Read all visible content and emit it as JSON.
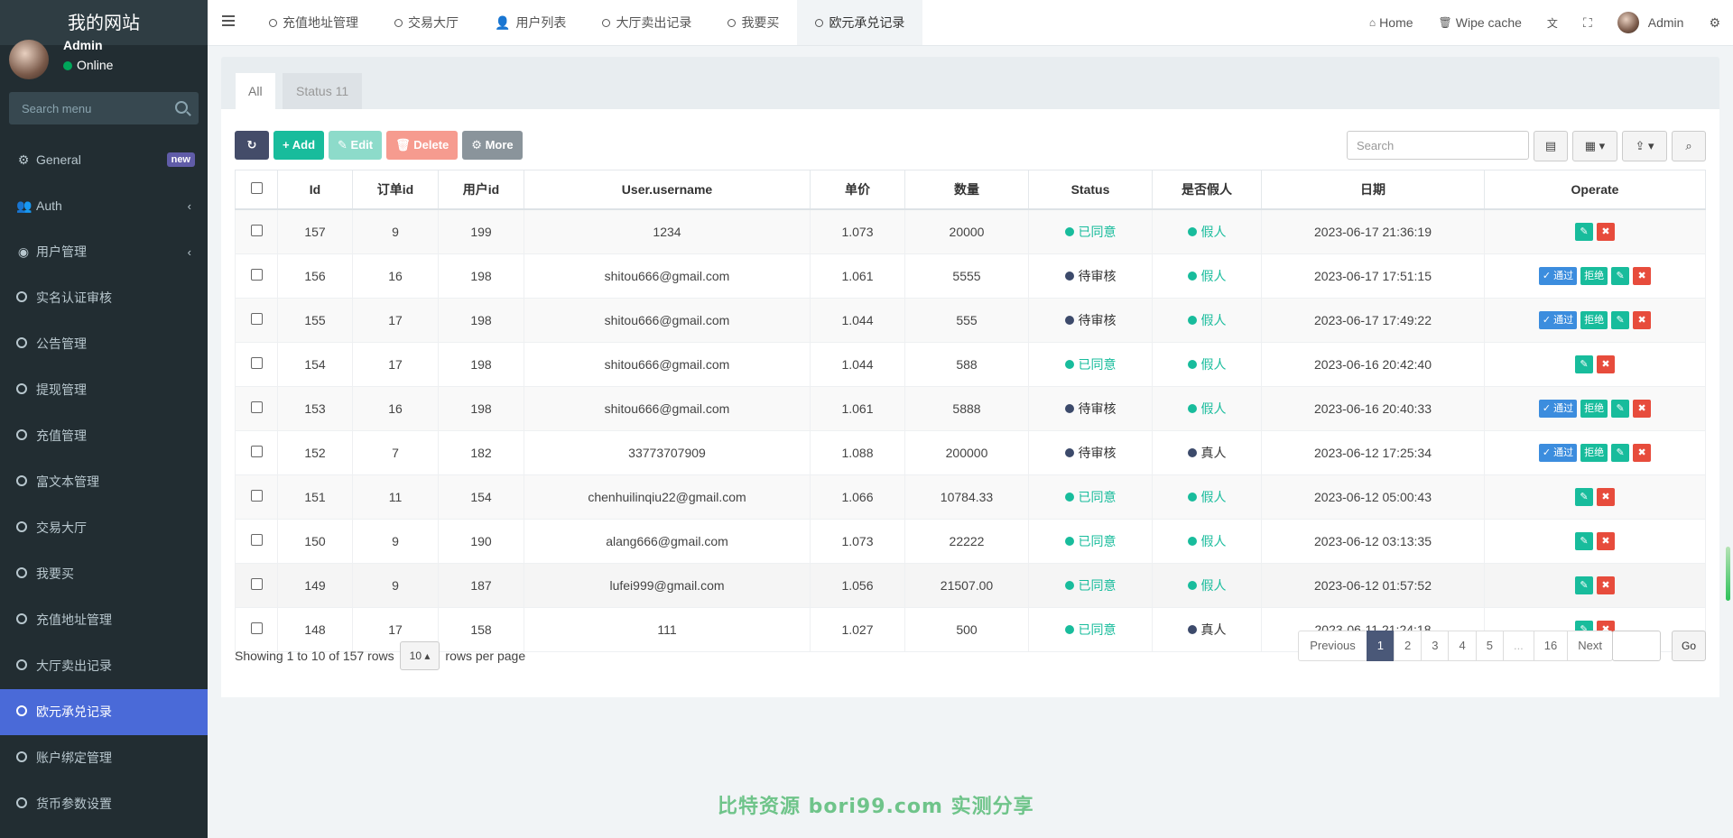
{
  "sidebar": {
    "logo": "我的网站",
    "user": {
      "name": "Admin",
      "status": "Online"
    },
    "search_placeholder": "Search menu",
    "items": [
      {
        "label": "General",
        "badge": "new"
      },
      {
        "label": "Auth"
      },
      {
        "label": "用户管理"
      },
      {
        "label": "实名认证审核"
      },
      {
        "label": "公告管理"
      },
      {
        "label": "提现管理"
      },
      {
        "label": "充值管理"
      },
      {
        "label": "富文本管理"
      },
      {
        "label": "交易大厅"
      },
      {
        "label": "我要买"
      },
      {
        "label": "充值地址管理"
      },
      {
        "label": "大厅卖出记录"
      },
      {
        "label": "欧元承兑记录"
      },
      {
        "label": "账户绑定管理"
      },
      {
        "label": "货币参数设置"
      }
    ]
  },
  "topbar": {
    "tabs": [
      "充值地址管理",
      "交易大厅",
      "用户列表",
      "大厅卖出记录",
      "我要买",
      "欧元承兑记录"
    ],
    "right": {
      "home": "Home",
      "wipe": "Wipe cache",
      "user": "Admin"
    }
  },
  "content": {
    "nav_tabs": [
      "All",
      "Status 11"
    ],
    "toolbar": {
      "add": "Add",
      "edit": "Edit",
      "delete": "Delete",
      "more": "More"
    },
    "search_placeholder": "Search",
    "columns": [
      "Id",
      "订单id",
      "用户id",
      "User.username",
      "单价",
      "数量",
      "Status",
      "是否假人",
      "日期",
      "Operate"
    ],
    "rows": [
      {
        "id": "157",
        "order": "9",
        "uid": "199",
        "username": "1234",
        "price": "1.073",
        "qty": "20000",
        "status": "已同意",
        "fake": "假人",
        "date": "2023-06-17 21:36:19"
      },
      {
        "id": "156",
        "order": "16",
        "uid": "198",
        "username": "shitou666@gmail.com",
        "price": "1.061",
        "qty": "5555",
        "status": "待审核",
        "fake": "假人",
        "date": "2023-06-17 17:51:15"
      },
      {
        "id": "155",
        "order": "17",
        "uid": "198",
        "username": "shitou666@gmail.com",
        "price": "1.044",
        "qty": "555",
        "status": "待审核",
        "fake": "假人",
        "date": "2023-06-17 17:49:22"
      },
      {
        "id": "154",
        "order": "17",
        "uid": "198",
        "username": "shitou666@gmail.com",
        "price": "1.044",
        "qty": "588",
        "status": "已同意",
        "fake": "假人",
        "date": "2023-06-16 20:42:40"
      },
      {
        "id": "153",
        "order": "16",
        "uid": "198",
        "username": "shitou666@gmail.com",
        "price": "1.061",
        "qty": "5888",
        "status": "待审核",
        "fake": "假人",
        "date": "2023-06-16 20:40:33"
      },
      {
        "id": "152",
        "order": "7",
        "uid": "182",
        "username": "33773707909",
        "price": "1.088",
        "qty": "200000",
        "status": "待审核",
        "fake": "真人",
        "date": "2023-06-12 17:25:34"
      },
      {
        "id": "151",
        "order": "11",
        "uid": "154",
        "username": "chenhuilinqiu22@gmail.com",
        "price": "1.066",
        "qty": "10784.33",
        "status": "已同意",
        "fake": "假人",
        "date": "2023-06-12 05:00:43"
      },
      {
        "id": "150",
        "order": "9",
        "uid": "190",
        "username": "alang666@gmail.com",
        "price": "1.073",
        "qty": "22222",
        "status": "已同意",
        "fake": "假人",
        "date": "2023-06-12 03:13:35"
      },
      {
        "id": "149",
        "order": "9",
        "uid": "187",
        "username": "lufei999@gmail.com",
        "price": "1.056",
        "qty": "21507.00",
        "status": "已同意",
        "fake": "假人",
        "date": "2023-06-12 01:57:52"
      },
      {
        "id": "148",
        "order": "17",
        "uid": "158",
        "username": "111",
        "price": "1.027",
        "qty": "500",
        "status": "已同意",
        "fake": "真人",
        "date": "2023-06-11 21:24:18"
      }
    ],
    "ops": {
      "pass": "通过",
      "reject": "拒绝"
    },
    "footer": {
      "showing": "Showing 1 to 10 of 157 rows",
      "per_page": "10",
      "per_page_suffix": "rows per page"
    },
    "pager": {
      "prev": "Previous",
      "pages": [
        "1",
        "2",
        "3",
        "4",
        "5",
        "...",
        "16"
      ],
      "next": "Next",
      "go": "Go"
    }
  },
  "watermark": "比特资源 bori99.com 实测分享",
  "colors": {
    "sidebar_bg": "#222d32",
    "active_menu": "#4a6ad8",
    "success": "#18bc9c",
    "danger": "#e74c3c",
    "primary": "#3c8dde"
  }
}
